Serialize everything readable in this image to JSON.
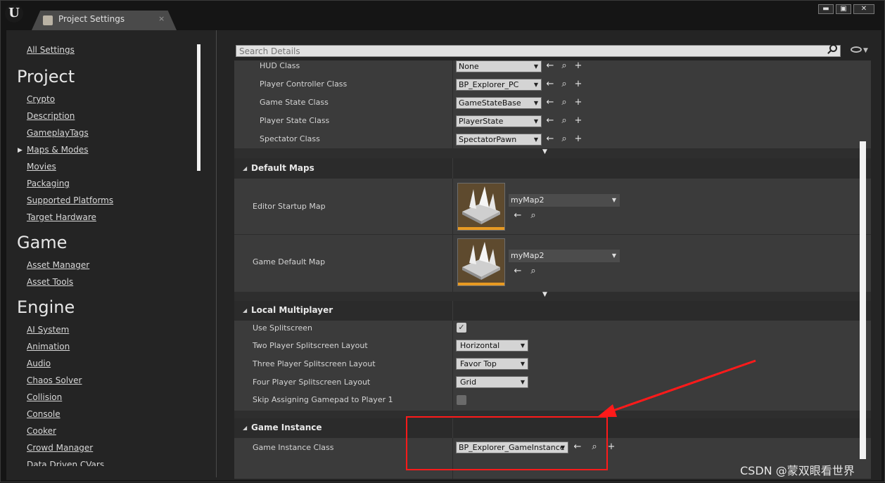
{
  "window": {
    "tab_title": "Project Settings",
    "tab_close": "×",
    "minimize": "▬",
    "maximize": "▣",
    "close": "✕"
  },
  "search": {
    "placeholder": "Search Details"
  },
  "sidebar": {
    "all_settings": "All Settings",
    "sections": [
      {
        "title": "Project",
        "items": [
          "Crypto",
          "Description",
          "GameplayTags",
          "Maps & Modes",
          "Movies",
          "Packaging",
          "Supported Platforms",
          "Target Hardware"
        ]
      },
      {
        "title": "Game",
        "items": [
          "Asset Manager",
          "Asset Tools"
        ]
      },
      {
        "title": "Engine",
        "items": [
          "AI System",
          "Animation",
          "Audio",
          "Chaos Solver",
          "Collision",
          "Console",
          "Cooker",
          "Crowd Manager",
          "Data Driven CVars"
        ]
      }
    ],
    "selected": "Maps & Modes"
  },
  "selected_game_mode": {
    "rows": [
      {
        "label": "HUD Class",
        "value": "None"
      },
      {
        "label": "Player Controller Class",
        "value": "BP_Explorer_PC"
      },
      {
        "label": "Game State Class",
        "value": "GameStateBase"
      },
      {
        "label": "Player State Class",
        "value": "PlayerState"
      },
      {
        "label": "Spectator Class",
        "value": "SpectatorPawn"
      }
    ]
  },
  "default_maps": {
    "title": "Default Maps",
    "rows": [
      {
        "label": "Editor Startup Map",
        "value": "myMap2"
      },
      {
        "label": "Game Default Map",
        "value": "myMap2"
      }
    ]
  },
  "local_multiplayer": {
    "title": "Local Multiplayer",
    "use_splitscreen": {
      "label": "Use Splitscreen",
      "checked": true
    },
    "rows": [
      {
        "label": "Two Player Splitscreen Layout",
        "value": "Horizontal"
      },
      {
        "label": "Three Player Splitscreen Layout",
        "value": "Favor Top"
      },
      {
        "label": "Four Player Splitscreen Layout",
        "value": "Grid"
      }
    ],
    "skip_gamepad": {
      "label": "Skip Assigning Gamepad to Player 1",
      "checked": false
    }
  },
  "game_instance": {
    "title": "Game Instance",
    "label": "Game Instance Class",
    "value": "BP_Explorer_GameInstance"
  },
  "annotation": {
    "highlight_color": "#ff1a1a"
  },
  "watermark": "CSDN @蒙双眼看世界",
  "icons": {
    "use_selected": "←",
    "browse": "⌕",
    "add": "+",
    "collapse": "▼",
    "checked": "✓",
    "dropdown": "▼"
  }
}
